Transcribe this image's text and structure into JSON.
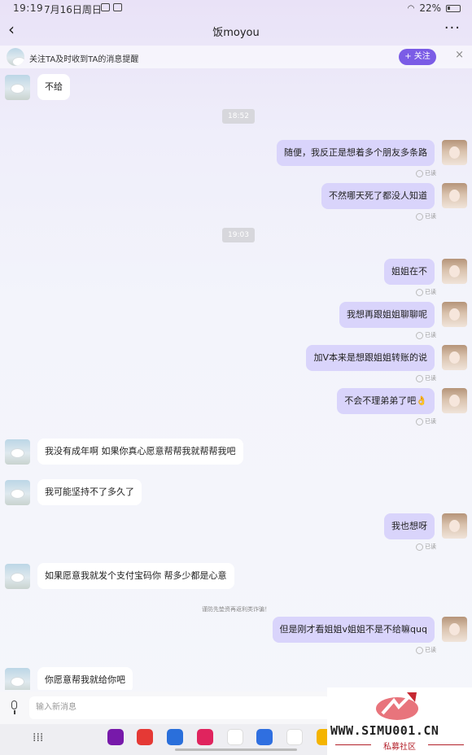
{
  "status": {
    "time": "19:19",
    "date": "7月16日周日",
    "battery": "22%"
  },
  "header": {
    "title": "饭moyou",
    "more": "···"
  },
  "follow": {
    "text": "关注TA及时收到TA的消息提醒",
    "button": "+ 关注",
    "close": "×"
  },
  "messages": [
    {
      "side": "left",
      "text": "不给"
    },
    {
      "type": "time",
      "text": "18:52"
    },
    {
      "side": "right",
      "text": "随便，我反正是想着多个朋友多条路",
      "read": "已读"
    },
    {
      "side": "right",
      "text": "不然哪天死了都没人知道",
      "read": "已读"
    },
    {
      "type": "time",
      "text": "19:03"
    },
    {
      "side": "right",
      "text": "姐姐在不",
      "read": "已读"
    },
    {
      "side": "right",
      "text": "我想再跟姐姐聊聊呢",
      "read": "已读"
    },
    {
      "side": "right",
      "text": "加V本来是想跟姐姐转账的说",
      "read": "已读"
    },
    {
      "side": "right",
      "text": "不会不理弟弟了吧👌",
      "read": "已读"
    },
    {
      "side": "left",
      "text": "我没有成年啊 如果你真心愿意帮帮我就帮帮我吧"
    },
    {
      "side": "left",
      "text": "我可能坚持不了多久了"
    },
    {
      "side": "right",
      "text": "我也想呀",
      "read": "已读"
    },
    {
      "side": "left",
      "text": "如果愿意我就发个支付宝码你 帮多少都是心意"
    },
    {
      "type": "notice",
      "text": "谨防先垫资再返利类诈骗！"
    },
    {
      "side": "right",
      "text": "但是刚才看姐姐v姐姐不是不给嘛quq",
      "read": "已读"
    },
    {
      "side": "left",
      "text": "你愿意帮我就给你吧"
    }
  ],
  "input": {
    "placeholder": "输入新消息"
  },
  "watermark": {
    "site": "WWW.SIMU001.CN",
    "sub": "私募社区"
  },
  "colors": {
    "accent": "#7b5ce6",
    "outgoing_bubble": "#d9d4fb",
    "incoming_bubble": "#ffffff",
    "watermark_red": "#b3202a"
  }
}
